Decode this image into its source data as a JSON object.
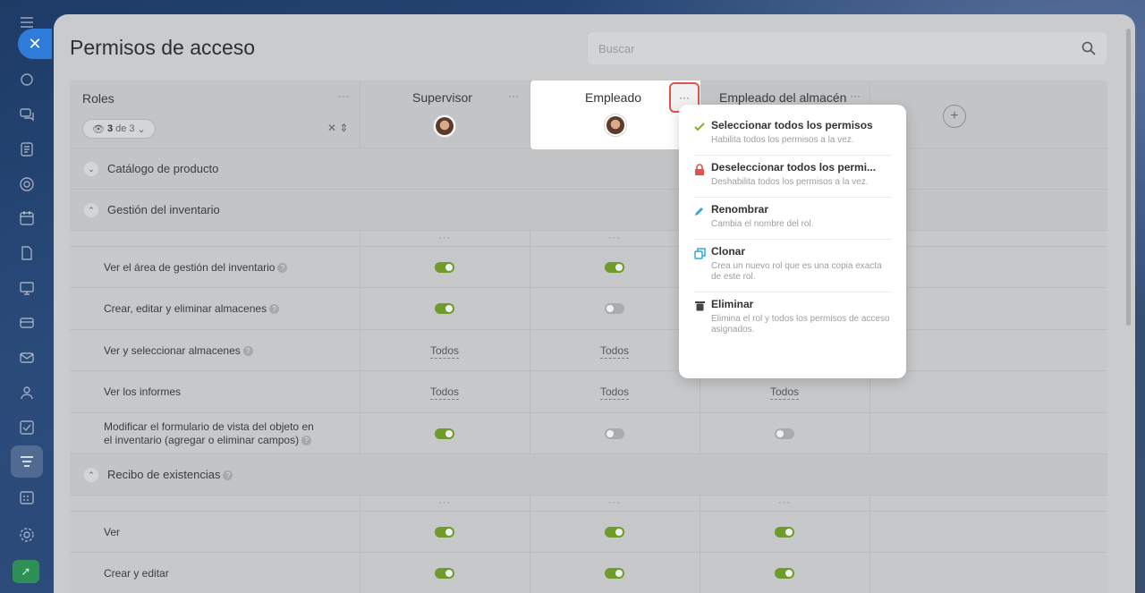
{
  "page": {
    "title": "Permisos de acceso",
    "search_placeholder": "Buscar"
  },
  "header": {
    "roles_label": "Roles",
    "filter_count": "3",
    "filter_total": "de 3",
    "columns": [
      {
        "name": "Supervisor"
      },
      {
        "name": "Empleado"
      },
      {
        "name": "Empleado del almacén"
      }
    ],
    "more_glyph": "···",
    "add_glyph": "+"
  },
  "groups": {
    "catalogo": "Catálogo de producto",
    "inventario": "Gestión del inventario",
    "recibo": "Recibo de existencias"
  },
  "inventory_rows": [
    {
      "label": "Ver el área de gestión del inventario",
      "values": [
        "on",
        "on",
        ""
      ]
    },
    {
      "label": "Crear, editar y eliminar almacenes",
      "values": [
        "on",
        "off",
        ""
      ]
    },
    {
      "label": "Ver y seleccionar almacenes",
      "values": [
        "Todos",
        "Todos",
        ""
      ]
    },
    {
      "label": "Ver los informes",
      "values": [
        "Todos",
        "Todos",
        "Todos"
      ]
    },
    {
      "label_line1": "Modificar el formulario de vista del objeto en",
      "label_line2": "el inventario (agregar o eliminar campos)",
      "values": [
        "on",
        "off",
        "off"
      ]
    }
  ],
  "receipt_rows": [
    {
      "label": "Ver",
      "values": [
        "on",
        "on",
        "on"
      ]
    },
    {
      "label": "Crear y editar",
      "values": [
        "on",
        "on",
        "on"
      ]
    }
  ],
  "menu": {
    "items": [
      {
        "title": "Seleccionar todos los permisos",
        "desc": "Habilita todos los permisos a la vez.",
        "icon": "check-icon",
        "color": "#7cb518"
      },
      {
        "title": "Deseleccionar todos los permi...",
        "desc": "Deshabilita todos los permisos a la vez.",
        "icon": "lock-icon",
        "color": "#e0524b"
      },
      {
        "title": "Renombrar",
        "desc": "Cambia el nombre del rol.",
        "icon": "pencil-icon",
        "color": "#2fa7e0"
      },
      {
        "title": "Clonar",
        "desc": "Crea un nuevo rol que es una copia exacta de este rol.",
        "icon": "clone-icon",
        "color": "#2fa7e0"
      },
      {
        "title": "Eliminar",
        "desc": "Elimina el rol y todos los permisos de acceso asignados.",
        "icon": "trash-icon",
        "color": "#444444"
      }
    ]
  },
  "colors": {
    "toggle_on": "#6e9b2b",
    "toggle_off": "#a9abad",
    "accent_blue": "#2f7bd9",
    "highlight_border": "#e0524b"
  }
}
